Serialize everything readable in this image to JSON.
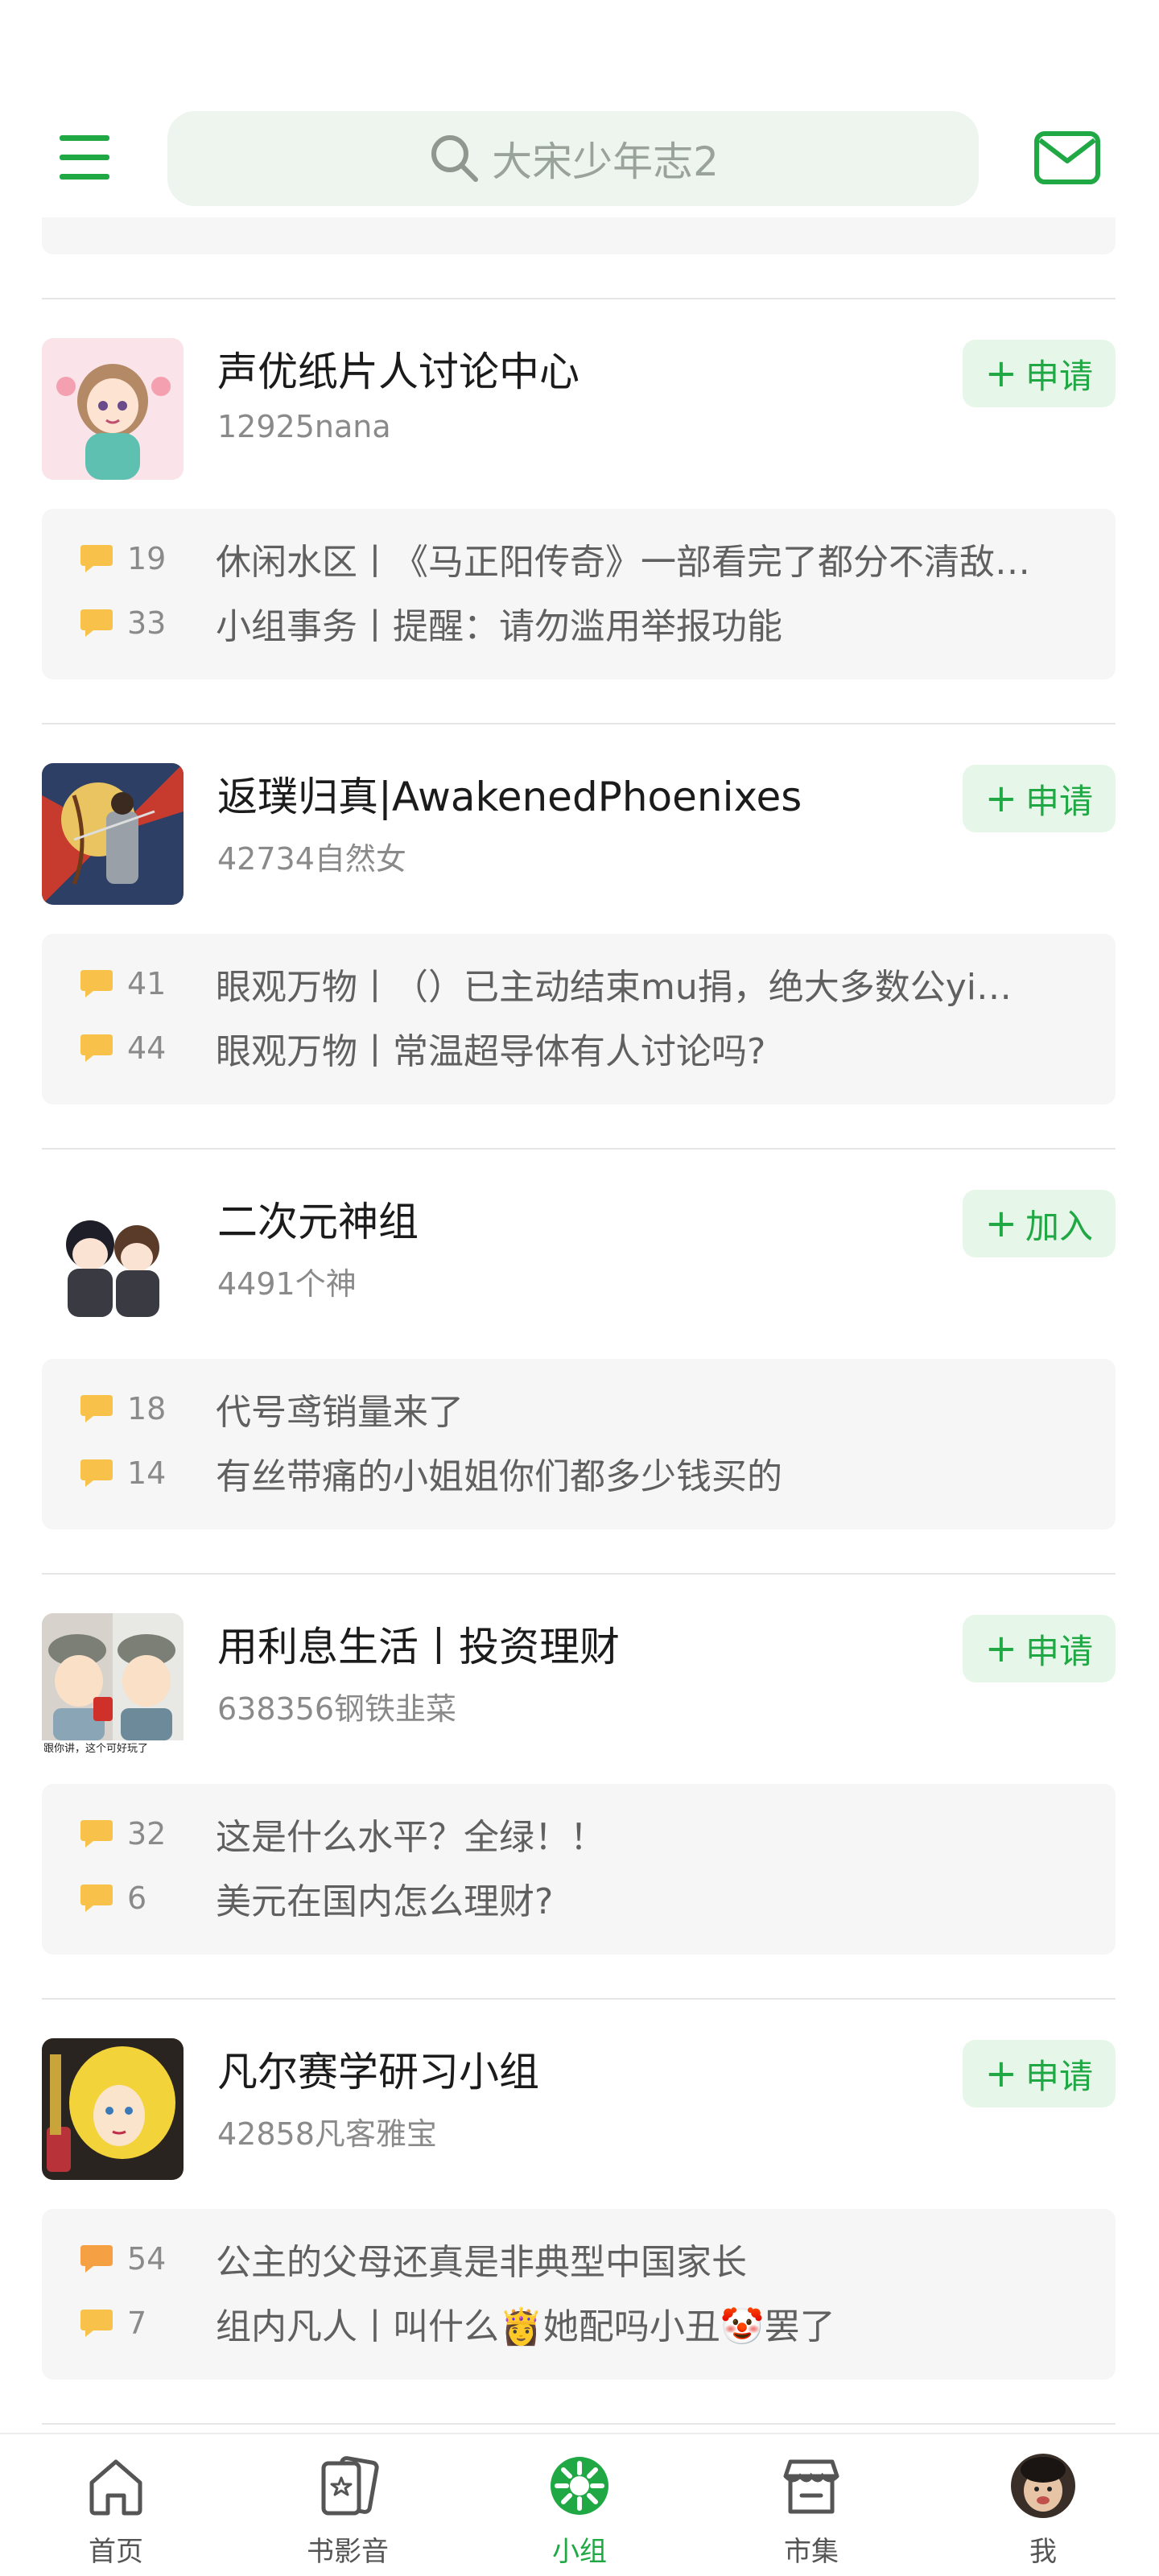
{
  "header": {
    "search_placeholder": "大宋少年志2"
  },
  "groups": [
    {
      "name": "声优纸片人讨论中心",
      "meta": "12925nana",
      "action": "申请",
      "topics": [
        {
          "count": "19",
          "title": "休闲水区丨《马正阳传奇》一部看完了都分不清敌…"
        },
        {
          "count": "33",
          "title": "小组事务丨提醒：请勿滥用举报功能"
        }
      ]
    },
    {
      "name": "返璞归真|AwakenedPhoenixes",
      "meta": "42734自然女",
      "action": "申请",
      "topics": [
        {
          "count": "41",
          "title": "眼观万物丨（）已主动结束mu捐，绝大多数公yi…"
        },
        {
          "count": "44",
          "title": "眼观万物丨常温超导体有人讨论吗?"
        }
      ]
    },
    {
      "name": "二次元神组",
      "meta": "4491个神",
      "action": "加入",
      "topics": [
        {
          "count": "18",
          "title": "代号鸢销量来了"
        },
        {
          "count": "14",
          "title": "有丝带痛的小姐姐你们都多少钱买的"
        }
      ]
    },
    {
      "name": "用利息生活丨投资理财",
      "meta": "638356钢铁韭菜",
      "action": "申请",
      "avatar_caption": "跟你讲，这个可好玩了",
      "topics": [
        {
          "count": "32",
          "title": "这是什么水平？全绿！！"
        },
        {
          "count": "6",
          "title": "美元在国内怎么理财?"
        }
      ]
    },
    {
      "name": "凡尔赛学研习小组",
      "meta": "42858凡客雅宝",
      "action": "申请",
      "topics": [
        {
          "count": "54",
          "title": "公主的父母还真是非典型中国家长"
        },
        {
          "count": "7",
          "title": "组内凡人丨叫什么👸她配吗小丑🤡罢了"
        }
      ]
    }
  ],
  "bottom_nav": [
    {
      "label": "首页",
      "icon": "home-icon"
    },
    {
      "label": "书影音",
      "icon": "media-icon"
    },
    {
      "label": "小组",
      "icon": "group-icon",
      "active": true
    },
    {
      "label": "市集",
      "icon": "market-icon"
    },
    {
      "label": "我",
      "icon": "profile-avatar"
    }
  ],
  "colors": {
    "accent": "#20a845",
    "accent_bg": "#e6f6e9",
    "search_bg": "#eef4ee",
    "topic_bg": "#f6f6f6",
    "bubble_yellow": "#f8c24a",
    "bubble_orange": "#f5a043"
  }
}
